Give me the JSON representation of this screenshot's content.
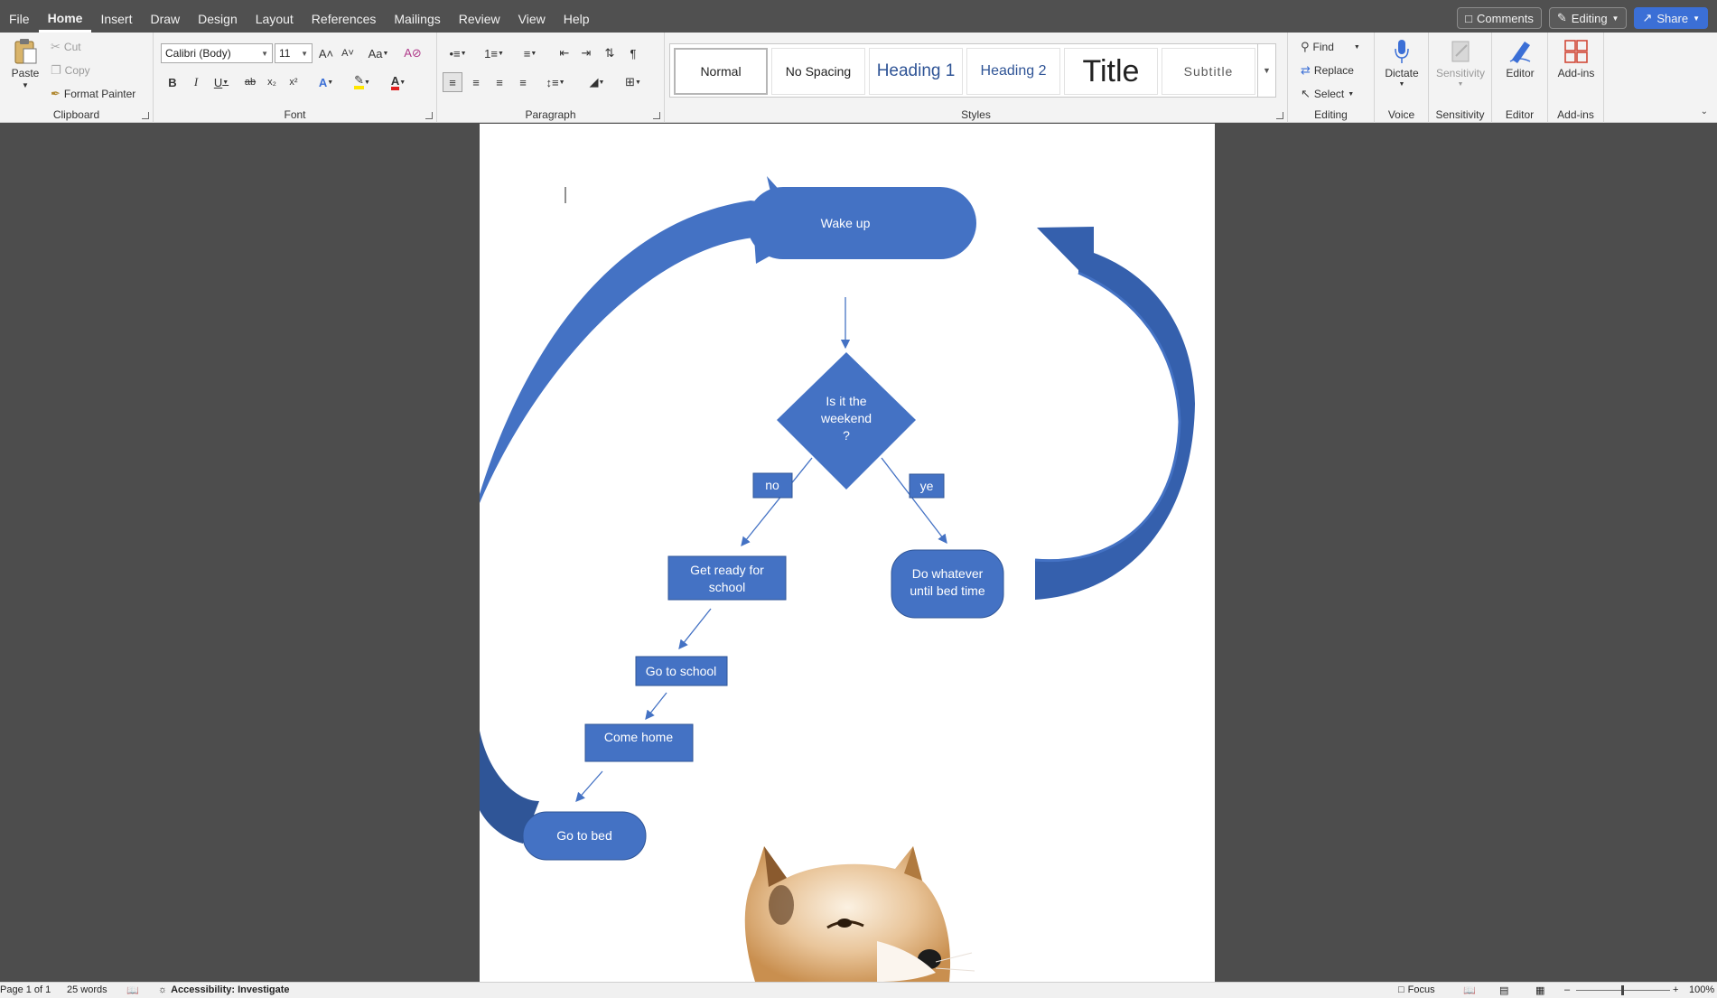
{
  "menu": {
    "tabs": [
      "File",
      "Home",
      "Insert",
      "Draw",
      "Design",
      "Layout",
      "References",
      "Mailings",
      "Review",
      "View",
      "Help"
    ],
    "active": "Home"
  },
  "top_right": {
    "comments": "Comments",
    "editing": "Editing",
    "share": "Share"
  },
  "clipboard": {
    "paste": "Paste",
    "cut": "Cut",
    "copy": "Copy",
    "format_painter": "Format Painter",
    "label": "Clipboard"
  },
  "font": {
    "name": "Calibri (Body)",
    "size": "11",
    "label": "Font",
    "case": "Aa",
    "bold": "B",
    "italic": "I",
    "underline": "U",
    "strike": "ab",
    "subscript": "x₂",
    "superscript": "x²",
    "grow": "A˄",
    "shrink": "A˅",
    "effects": "A",
    "highlight": "ab",
    "color": "A"
  },
  "paragraph": {
    "label": "Paragraph"
  },
  "styles": {
    "label": "Styles",
    "items": [
      "Normal",
      "No Spacing",
      "Heading 1",
      "Heading 2",
      "Title",
      "Subtitle"
    ]
  },
  "editing": {
    "find": "Find",
    "replace": "Replace",
    "select": "Select",
    "label": "Editing"
  },
  "voice": {
    "dictate": "Dictate",
    "label": "Voice"
  },
  "sensitivity": {
    "button": "Sensitivity",
    "label": "Sensitivity"
  },
  "editor": {
    "button": "Editor",
    "label": "Editor"
  },
  "addins": {
    "button": "Add-ins",
    "label": "Add-ins"
  },
  "flowchart": {
    "wake_up": "Wake up",
    "decision_line1": "Is it the",
    "decision_line2": "weekend",
    "decision_line3": "?",
    "no_label": "no",
    "yes_label": "ye",
    "get_ready_line1": "Get ready for",
    "get_ready_line2": "school",
    "do_whatever_line1": "Do whatever",
    "do_whatever_line2": "until bed time",
    "go_to_school": "Go to school",
    "come_home": "Come home",
    "go_to_bed": "Go to bed",
    "shape_color": "#4472c4",
    "arrow_color": "#3a65b5"
  },
  "status": {
    "page": "Page 1 of 1",
    "words": "25 words",
    "accessibility": "Accessibility: Investigate",
    "focus": "Focus",
    "zoom": "100%"
  },
  "colors": {
    "ribbon_bg": "#f3f3f3",
    "app_bg": "#4d4d4d",
    "share_blue": "#3b6fd6",
    "heading_blue": "#2f5496"
  }
}
